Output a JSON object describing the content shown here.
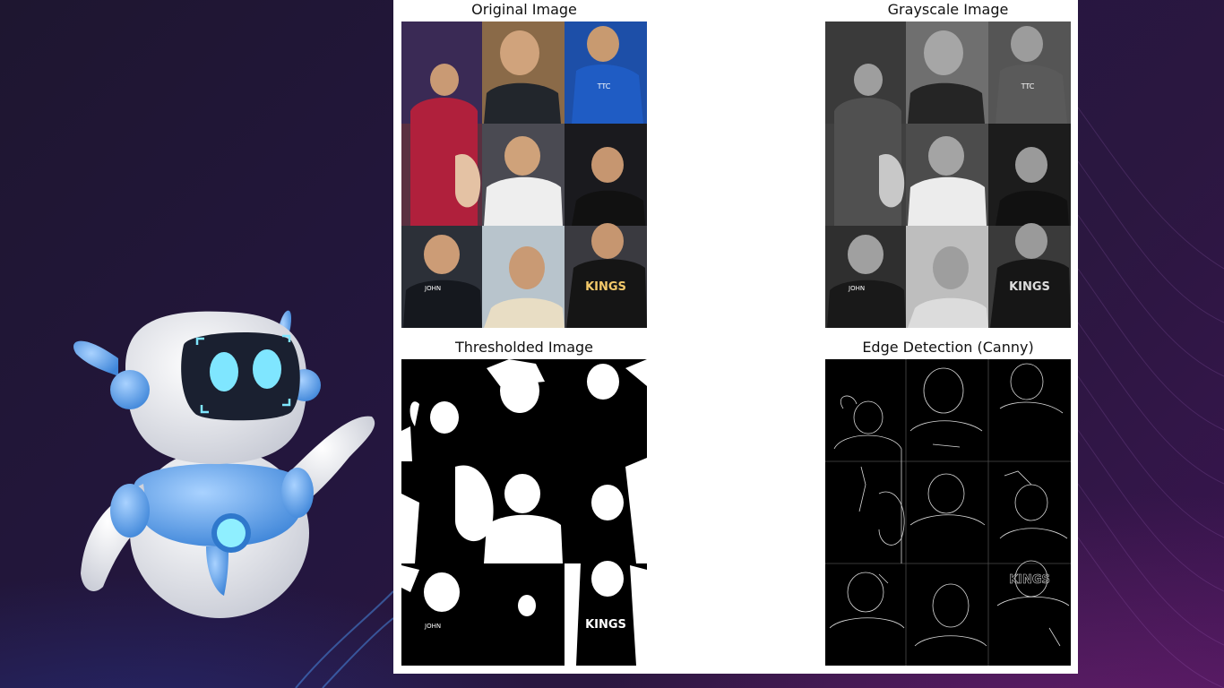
{
  "figure": {
    "panels": [
      {
        "title": "Original Image",
        "kind": "color"
      },
      {
        "title": "Grayscale Image",
        "kind": "gray"
      },
      {
        "title": "Thresholded Image",
        "kind": "threshold"
      },
      {
        "title": "Edge Detection (Canny)",
        "kind": "edges"
      }
    ]
  },
  "collage_text": {
    "kings": "KINGS",
    "name_tag": "JOHN",
    "badge": "TTC"
  },
  "colors": {
    "background_dark": "#1e1630",
    "accent_purple": "#3a1450",
    "accent_blue": "#4aa3f0",
    "robot_eye": "#7fe6ff",
    "panel_bg": "#ffffff"
  },
  "icons": {
    "mascot": "robot-mascot-icon"
  }
}
